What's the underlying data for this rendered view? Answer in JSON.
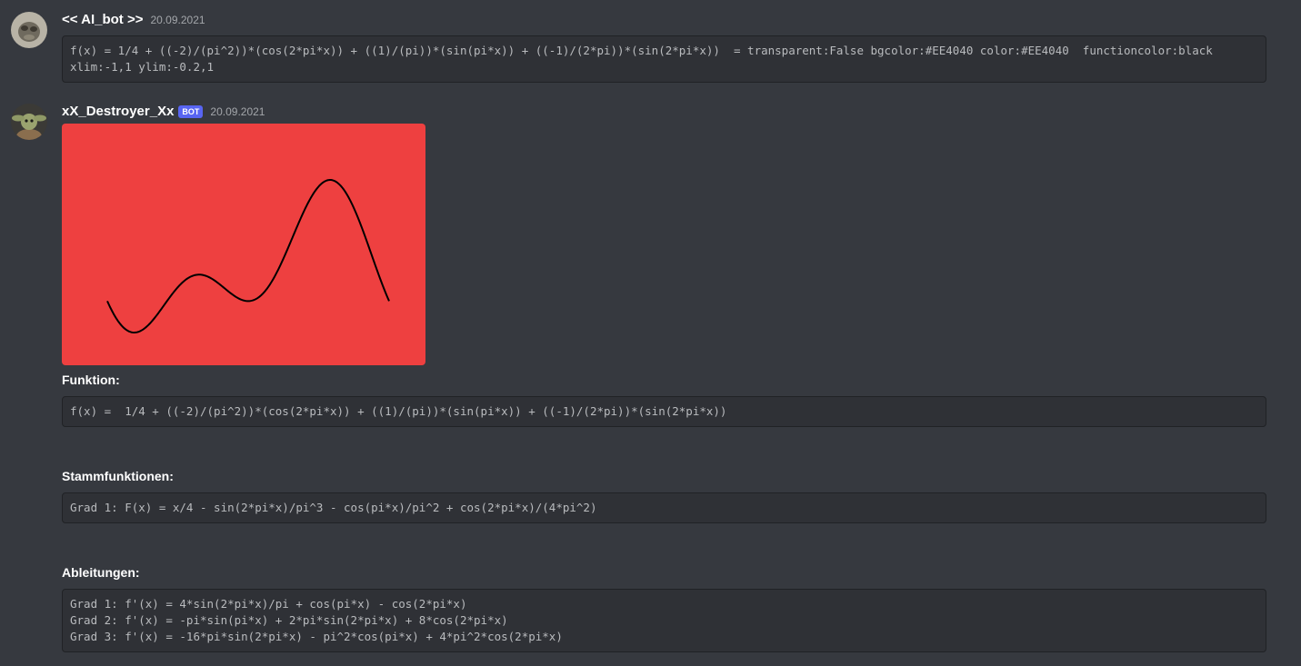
{
  "message1": {
    "author": "<< AI_bot >>",
    "timestamp": "20.09.2021",
    "code_lines": [
      "f(x) = 1/4 + ((-2)/(pi^2))*(cos(2*pi*x)) + ((1)/(pi))*(sin(pi*x)) + ((-1)/(2*pi))*(sin(2*pi*x))  = transparent:False bgcolor:#EE4040 color:#EE4040  functioncolor:black",
      "xlim:-1,1 ylim:-0.2,1"
    ]
  },
  "message2": {
    "author": "xX_Destroyer_Xx",
    "bot_tag": "BOT",
    "timestamp": "20.09.2021",
    "plot": {
      "bgcolor": "#EE4040",
      "functioncolor": "#000000"
    },
    "funktion_title": "Funktion:",
    "funktion_code": "f(x) =  1/4 + ((-2)/(pi^2))*(cos(2*pi*x)) + ((1)/(pi))*(sin(pi*x)) + ((-1)/(2*pi))*(sin(2*pi*x))",
    "stamm_title": "Stammfunktionen:",
    "stamm_code": "Grad 1: F(x) = x/4 - sin(2*pi*x)/pi^3 - cos(pi*x)/pi^2 + cos(2*pi*x)/(4*pi^2)",
    "ableitungen_title": "Ableitungen:",
    "ableitungen_lines": [
      "Grad 1: f'(x) = 4*sin(2*pi*x)/pi + cos(pi*x) - cos(2*pi*x)",
      "Grad 2: f'(x) = -pi*sin(pi*x) + 2*pi*sin(2*pi*x) + 8*cos(2*pi*x)",
      "Grad 3: f'(x) = -16*pi*sin(2*pi*x) - pi^2*cos(pi*x) + 4*pi^2*cos(2*pi*x)"
    ]
  },
  "colors": {
    "background": "#36393f",
    "codeblock": "#2f3136",
    "bot_tag": "#5865f2"
  }
}
